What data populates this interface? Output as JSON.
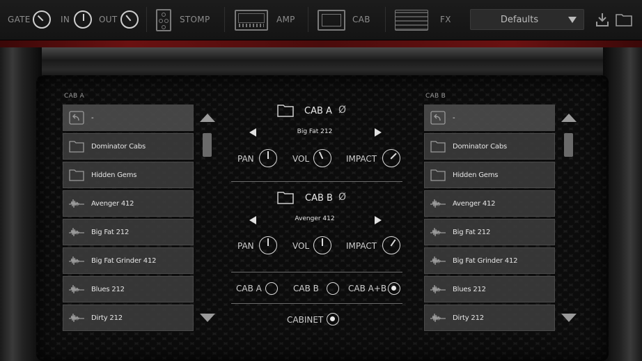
{
  "toolbar": {
    "gate_label": "GATE",
    "in_label": "IN",
    "out_label": "OUT",
    "stomp_label": "STOMP",
    "amp_label": "AMP",
    "cab_label": "CAB",
    "fx_label": "FX",
    "preset_value": "Defaults"
  },
  "cab_a_browser": {
    "label": "CAB A",
    "items": [
      {
        "type": "back",
        "label": "-"
      },
      {
        "type": "folder",
        "label": "Dominator Cabs"
      },
      {
        "type": "folder",
        "label": "Hidden Gems"
      },
      {
        "type": "ir",
        "label": "Avenger 412"
      },
      {
        "type": "ir",
        "label": "Big Fat 212"
      },
      {
        "type": "ir",
        "label": "Big Fat Grinder 412"
      },
      {
        "type": "ir",
        "label": "Blues 212"
      },
      {
        "type": "ir",
        "label": "Dirty 212"
      }
    ]
  },
  "cab_b_browser": {
    "label": "CAB B",
    "items": [
      {
        "type": "back",
        "label": "-"
      },
      {
        "type": "folder",
        "label": "Dominator Cabs"
      },
      {
        "type": "folder",
        "label": "Hidden Gems"
      },
      {
        "type": "ir",
        "label": "Avenger 412"
      },
      {
        "type": "ir",
        "label": "Big Fat 212"
      },
      {
        "type": "ir",
        "label": "Big Fat Grinder 412"
      },
      {
        "type": "ir",
        "label": "Blues 212"
      },
      {
        "type": "ir",
        "label": "Dirty 212"
      }
    ]
  },
  "center": {
    "cab_a": {
      "title": "CAB A",
      "phase": "Ø",
      "selected": "Big Fat 212",
      "pan_label": "PAN",
      "vol_label": "VOL",
      "impact_label": "IMPACT"
    },
    "cab_b": {
      "title": "CAB B",
      "phase": "Ø",
      "selected": "Avenger 412",
      "pan_label": "PAN",
      "vol_label": "VOL",
      "impact_label": "IMPACT"
    },
    "routing": {
      "opt_a": "CAB A",
      "opt_b": "CAB B",
      "opt_ab": "CAB A+B",
      "selected": "CAB A+B"
    },
    "cabinet_label": "CABINET"
  },
  "colors": {
    "accent_red": "#6a1111",
    "row_bg": "#3c3c3c",
    "text": "#e6e6e6"
  }
}
